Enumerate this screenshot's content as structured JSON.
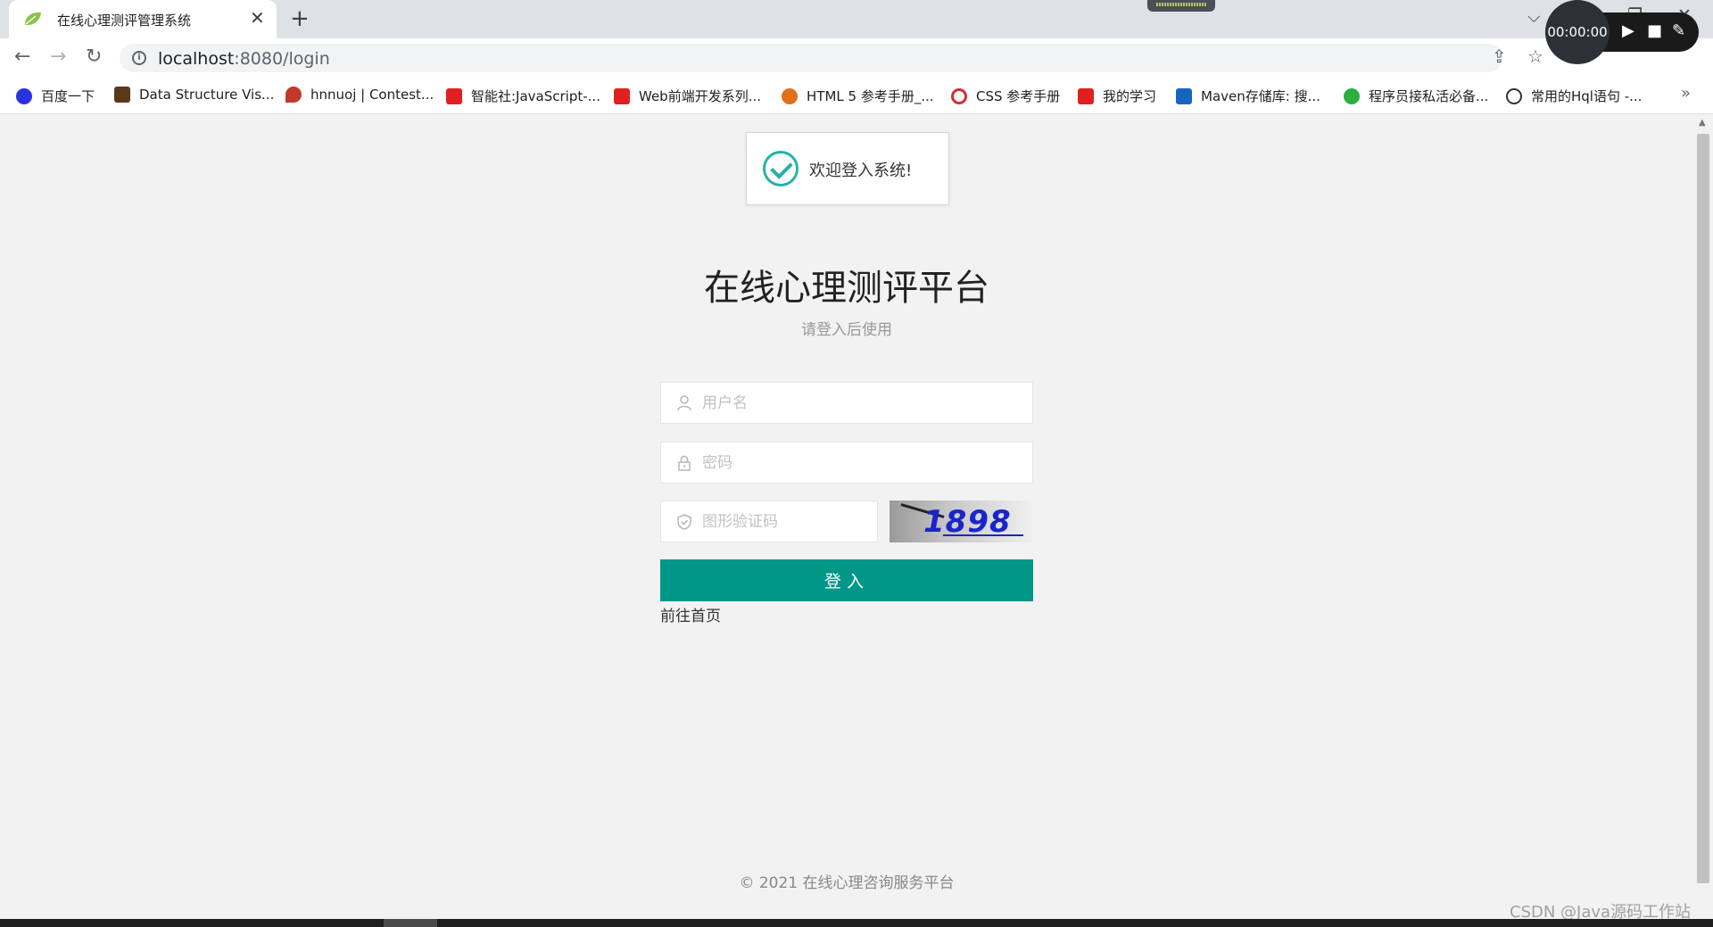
{
  "browser": {
    "tab_title": "在线心理测评管理系统",
    "tab_close": "✕",
    "new_tab": "+",
    "url_host": "localhost",
    "url_rest": ":8080/login",
    "bookmarks": [
      {
        "label": "百度一下",
        "color": "#2932e1"
      },
      {
        "label": "Data Structure Vis...",
        "color": "#5a3a1a"
      },
      {
        "label": "hnnuoj | Contest...",
        "color": "#c0392b"
      },
      {
        "label": "智能社:JavaScript-...",
        "color": "#e02020"
      },
      {
        "label": "Web前端开发系列...",
        "color": "#e02020"
      },
      {
        "label": "HTML 5 参考手册_...",
        "color": "#e0701a"
      },
      {
        "label": "CSS 参考手册",
        "color": "#d32f2f"
      },
      {
        "label": "我的学习",
        "color": "#e02020"
      },
      {
        "label": "Maven存储库: 搜...",
        "color": "#1565c0"
      },
      {
        "label": "程序员接私活必备...",
        "color": "#2aae3e"
      },
      {
        "label": "常用的Hql语句 -...",
        "color": "#333333"
      }
    ],
    "more": "»"
  },
  "recorder": {
    "time": "00:00:00"
  },
  "toast": {
    "message": "欢迎登入系统!"
  },
  "login": {
    "title": "在线心理测评平台",
    "subtitle": "请登入后使用",
    "username_placeholder": "用户名",
    "password_placeholder": "密码",
    "captcha_placeholder": "图形验证码",
    "captcha_text": "1898",
    "submit_label": "登入",
    "home_link": "前往首页"
  },
  "footer": {
    "text": "© 2021  在线心理咨询服务平台"
  },
  "watermark": "CSDN @Java源码工作站",
  "colors": {
    "primary": "#009688",
    "toast_accent": "#27b2a5"
  }
}
